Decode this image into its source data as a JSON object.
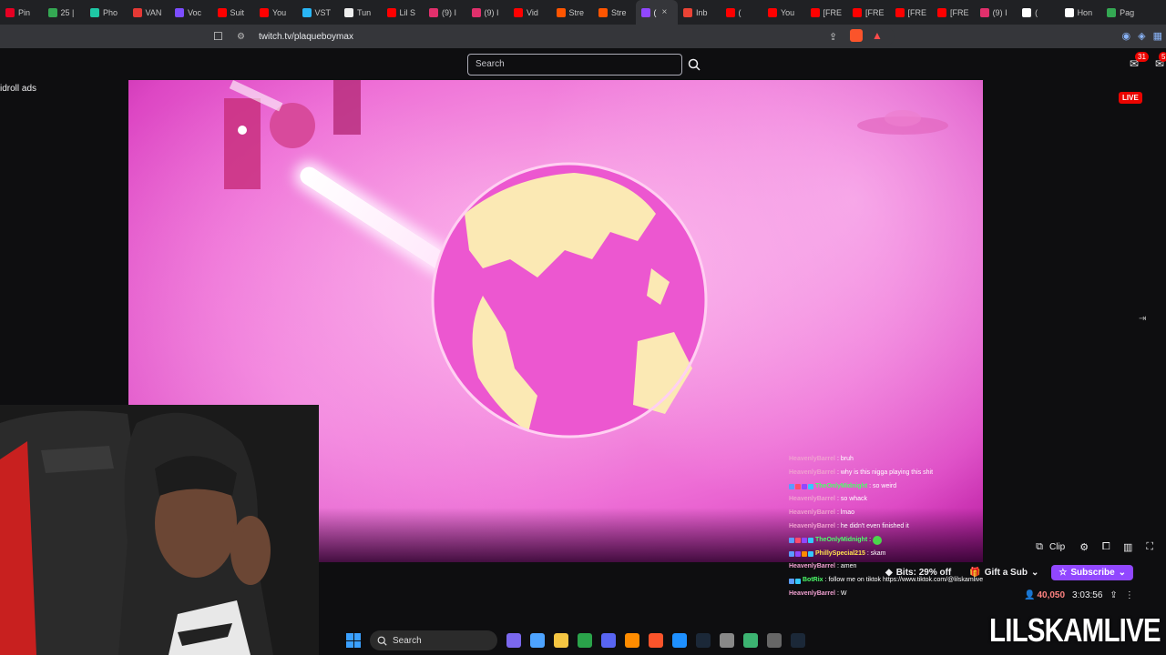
{
  "browser": {
    "tabs": [
      {
        "label": "Pin",
        "color": "#e60023"
      },
      {
        "label": "25 |",
        "color": "#34a853"
      },
      {
        "label": "Pho",
        "color": "#1ec8a5"
      },
      {
        "label": "VAN",
        "color": "#e53935"
      },
      {
        "label": "Voc",
        "color": "#7c4dff"
      },
      {
        "label": "Suit",
        "color": "#ff0000"
      },
      {
        "label": "You",
        "color": "#ff0000"
      },
      {
        "label": "VST",
        "color": "#29b6f6"
      },
      {
        "label": "Tun",
        "color": "#eeeeee"
      },
      {
        "label": "Lil S",
        "color": "#ff0000"
      },
      {
        "label": "(9) I",
        "color": "#e1306c"
      },
      {
        "label": "(9) I",
        "color": "#e1306c"
      },
      {
        "label": "Vid",
        "color": "#ff0000"
      },
      {
        "label": "Stre",
        "color": "#ff5500"
      },
      {
        "label": "Stre",
        "color": "#ff5500"
      },
      {
        "label": "(",
        "color": "#9147ff",
        "active": true
      },
      {
        "label": "Inb",
        "color": "#ea4335"
      },
      {
        "label": "(",
        "color": "#ff0000"
      },
      {
        "label": "You",
        "color": "#ff0000"
      },
      {
        "label": "[FRE",
        "color": "#ff0000"
      },
      {
        "label": "[FRE",
        "color": "#ff0000"
      },
      {
        "label": "[FRE",
        "color": "#ff0000"
      },
      {
        "label": "[FRE",
        "color": "#ff0000"
      },
      {
        "label": "(9) I",
        "color": "#e1306c"
      },
      {
        "label": "(",
        "color": "#ffffff"
      },
      {
        "label": "Hon",
        "color": "#ffffff"
      },
      {
        "label": "Pag",
        "color": "#34a853"
      }
    ],
    "active_close": "×",
    "url": "twitch.tv/plaqueboymax"
  },
  "twitch": {
    "search_placeholder": "Search",
    "notif_count": "31",
    "inbox_count": "5",
    "midroll": "idroll ads",
    "live": "LIVE",
    "clip_label": "Clip",
    "bits_label": "Bits: 29% off",
    "gift_label": "Gift a Sub",
    "subscribe_label": "Subscribe",
    "viewers": "40,050",
    "uptime": "3:03:56"
  },
  "chat": [
    {
      "user": "HeavenlyBarrel",
      "color": "#f0a0d0",
      "msg": ": bruh",
      "badges": []
    },
    {
      "user": "HeavenlyBarrel",
      "color": "#f0a0d0",
      "msg": ": why is this nigga playing this shit",
      "badges": []
    },
    {
      "user": "TheOnlyMidnight",
      "color": "#4cff6a",
      "msg": ": so weird",
      "badges": [
        "#5b9cff",
        "#ff4b6b",
        "#9147ff",
        "#34c8ff"
      ]
    },
    {
      "user": "HeavenlyBarrel",
      "color": "#f0a0d0",
      "msg": ": so whack",
      "badges": []
    },
    {
      "user": "HeavenlyBarrel",
      "color": "#f0a0d0",
      "msg": ": lmao",
      "badges": []
    },
    {
      "user": "HeavenlyBarrel",
      "color": "#f0a0d0",
      "msg": ": he didn't even finished it",
      "badges": []
    },
    {
      "user": "TheOnlyMidnight",
      "color": "#4cff6a",
      "msg": ":",
      "badges": [
        "#5b9cff",
        "#ff4b6b",
        "#9147ff",
        "#34c8ff"
      ],
      "emote": true
    },
    {
      "user": "PhillySpecial215",
      "color": "#ffe34c",
      "msg": ": skam",
      "badges": [
        "#5b9cff",
        "#9147ff",
        "#ff8a00",
        "#34c8ff"
      ]
    },
    {
      "user": "HeavenlyBarrel",
      "color": "#f0a0d0",
      "msg": ": amen",
      "badges": []
    },
    {
      "user": "BotRix",
      "color": "#4cff6a",
      "msg": ": follow me on tiktok https://www.tiktok.com/@lilskamlive",
      "badges": [
        "#5b9cff",
        "#34c8ff"
      ]
    },
    {
      "user": "HeavenlyBarrel",
      "color": "#f0a0d0",
      "msg": ": W",
      "badges": []
    }
  ],
  "taskbar": {
    "search_label": "Search",
    "icon_colors": [
      "#7b68ee",
      "#4da3ff",
      "#f4c542",
      "#2aa34a",
      "#5865f2",
      "#ff8c00",
      "#fb542b",
      "#1e90ff",
      "#1b2838",
      "#888888",
      "#3cb371",
      "#666666",
      "#1b2838"
    ]
  },
  "watermark": "LILSKAMLIVE"
}
